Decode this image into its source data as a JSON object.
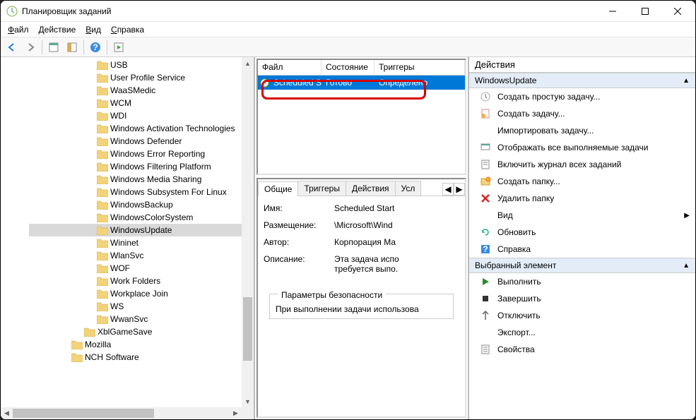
{
  "titlebar": {
    "title": "Планировщик заданий"
  },
  "menubar": {
    "file": "Файл",
    "action": "Действие",
    "view": "Вид",
    "help": "Справка"
  },
  "tree": {
    "items": [
      {
        "label": "USB",
        "level": 1
      },
      {
        "label": "User Profile Service",
        "level": 1
      },
      {
        "label": "WaaSMedic",
        "level": 1
      },
      {
        "label": "WCM",
        "level": 1
      },
      {
        "label": "WDI",
        "level": 1
      },
      {
        "label": "Windows Activation Technologies",
        "level": 1
      },
      {
        "label": "Windows Defender",
        "level": 1
      },
      {
        "label": "Windows Error Reporting",
        "level": 1
      },
      {
        "label": "Windows Filtering Platform",
        "level": 1
      },
      {
        "label": "Windows Media Sharing",
        "level": 1
      },
      {
        "label": "Windows Subsystem For Linux",
        "level": 1
      },
      {
        "label": "WindowsBackup",
        "level": 1
      },
      {
        "label": "WindowsColorSystem",
        "level": 1
      },
      {
        "label": "WindowsUpdate",
        "level": 1,
        "selected": true
      },
      {
        "label": "Wininet",
        "level": 1
      },
      {
        "label": "WlanSvc",
        "level": 1
      },
      {
        "label": "WOF",
        "level": 1
      },
      {
        "label": "Work Folders",
        "level": 1
      },
      {
        "label": "Workplace Join",
        "level": 1
      },
      {
        "label": "WS",
        "level": 1
      },
      {
        "label": "WwanSvc",
        "level": 1
      },
      {
        "label": "XblGameSave",
        "level": 0
      },
      {
        "label": "Mozilla",
        "level": -1
      },
      {
        "label": "NCH Software",
        "level": -1
      }
    ]
  },
  "task_list": {
    "cols": {
      "file": "Файл",
      "state": "Состояние",
      "triggers": "Триггеры"
    },
    "row": {
      "name": "Scheduled S...",
      "state": "Готово",
      "trigger": "Определено"
    }
  },
  "detail": {
    "tabs": {
      "general": "Общие",
      "triggers": "Триггеры",
      "actions": "Действия",
      "cond": "Усл"
    },
    "name_label": "Имя:",
    "name_value": "Scheduled Start",
    "loc_label": "Размещение:",
    "loc_value": "\\Microsoft\\Wind",
    "author_label": "Автор:",
    "author_value": "Корпорация Ма",
    "desc_label": "Описание:",
    "desc_value": "Эта задача испо\nтребуется выпо.",
    "security_legend": "Параметры безопасности",
    "security_text": "При выполнении задачи использова"
  },
  "actions": {
    "header": "Действия",
    "section1": "WindowsUpdate",
    "section2": "Выбранный элемент",
    "items1": [
      {
        "icon": "wand",
        "label": "Создать простую задачу..."
      },
      {
        "icon": "task",
        "label": "Создать задачу..."
      },
      {
        "icon": "blank",
        "label": "Импортировать задачу..."
      },
      {
        "icon": "display",
        "label": "Отображать все выполняемые задачи"
      },
      {
        "icon": "log",
        "label": "Включить журнал всех заданий"
      },
      {
        "icon": "newfolder",
        "label": "Создать папку..."
      },
      {
        "icon": "delete",
        "label": "Удалить папку"
      }
    ],
    "view_label": "Вид",
    "items1b": [
      {
        "icon": "refresh",
        "label": "Обновить"
      },
      {
        "icon": "help",
        "label": "Справка"
      }
    ],
    "items2": [
      {
        "icon": "play",
        "label": "Выполнить"
      },
      {
        "icon": "stop",
        "label": "Завершить"
      },
      {
        "icon": "disable",
        "label": "Отключить"
      },
      {
        "icon": "blank",
        "label": "Экспорт..."
      },
      {
        "icon": "props",
        "label": "Свойства"
      }
    ]
  }
}
